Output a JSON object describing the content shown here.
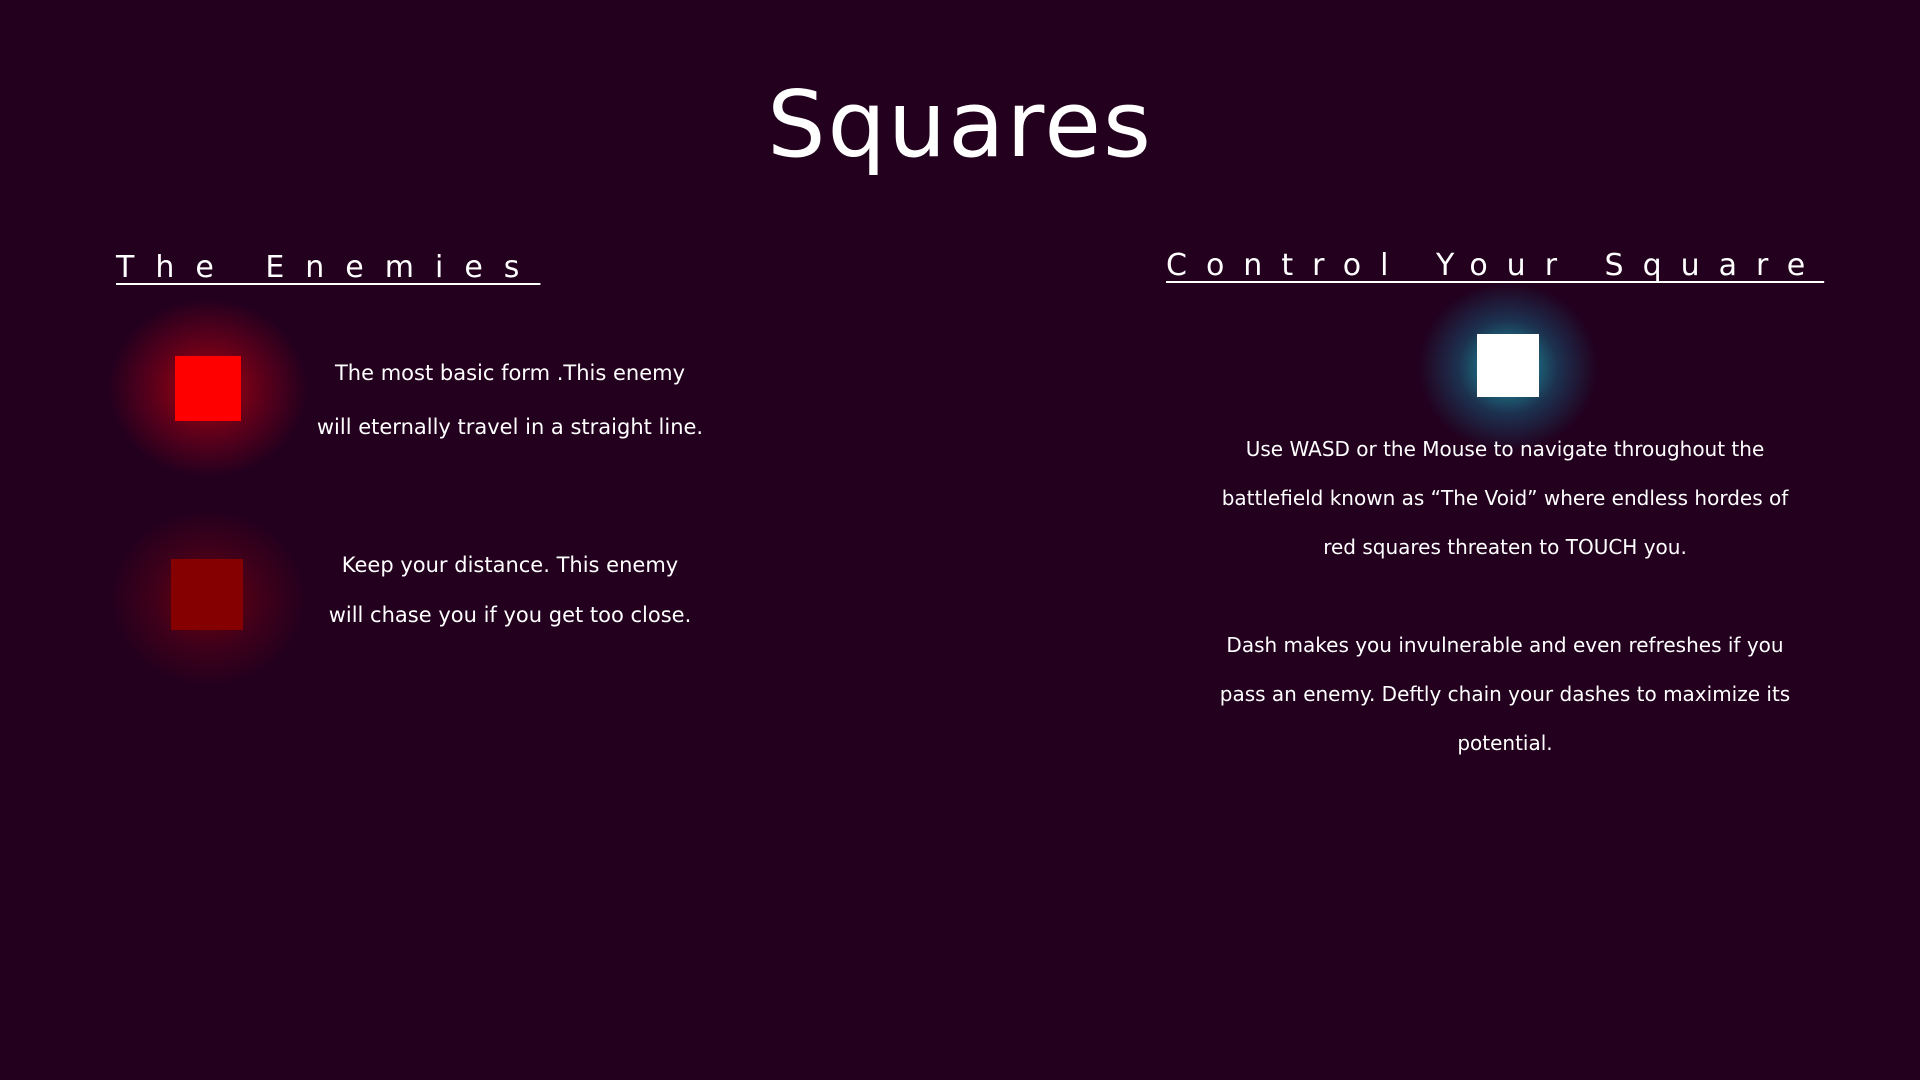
{
  "title": "Squares",
  "enemies": {
    "heading": "The Enemies",
    "basic": {
      "color": "#ff0000",
      "lines": [
        "The most basic form .This enemy",
        "will eternally travel in a straight line."
      ]
    },
    "chaser": {
      "color": "#850000",
      "lines": [
        "Keep your distance. This enemy",
        "will chase you if you get too close."
      ]
    }
  },
  "control": {
    "heading": "Control Your Square",
    "player_color": "#ffffff",
    "glow_color": "#1ebec8",
    "movement_lines": [
      "Use WASD or the Mouse to navigate throughout the",
      "battlefield known as “The Void” where endless hordes of",
      "red squares threaten to TOUCH you."
    ],
    "dash_lines": [
      "Dash makes you invulnerable and even refreshes if you",
      "pass an enemy. Deftly chain your dashes to maximize its",
      "potential."
    ]
  },
  "background_color": "#22001e"
}
